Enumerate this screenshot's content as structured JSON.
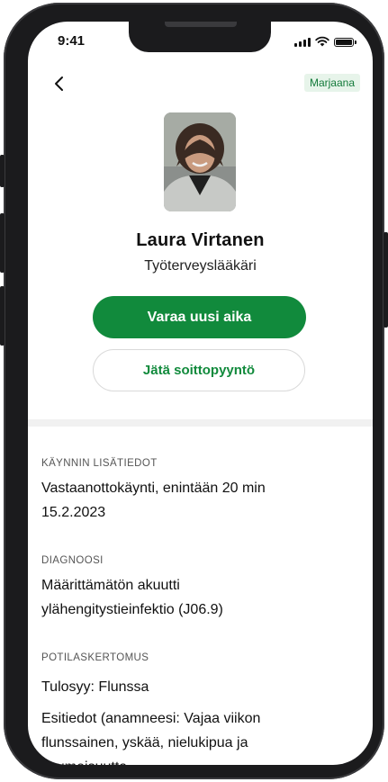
{
  "status_bar": {
    "time": "9:41"
  },
  "header": {
    "user_tag": "Marjaana"
  },
  "profile": {
    "name": "Laura Virtanen",
    "title": "Työterveyslääkäri"
  },
  "actions": {
    "book_label": "Varaa uusi aika",
    "callback_label": "Jätä soittopyyntö"
  },
  "sections": {
    "visit": {
      "label": "KÄYNNIN LISÄTIEDOT",
      "line1": "Vastaanottokäynti, enintään 20 min",
      "line2": "15.2.2023"
    },
    "diagnosis": {
      "label": "DIAGNOOSI",
      "line1": "Määrittämätön akuutti",
      "line2": "ylähengitystieinfektio (J06.9)"
    },
    "report": {
      "label": "POTILASKERTOMUS",
      "reason": "Tulosyy: Flunssa",
      "history_line1": "Esitiedot (anamneesi: Vajaa viikon",
      "history_line2": "flunssainen, yskää, nielukipua ja",
      "history_line3": "kuumeisuutta"
    }
  },
  "colors": {
    "accent": "#118a3c",
    "tag_bg": "#e7f4ea"
  }
}
